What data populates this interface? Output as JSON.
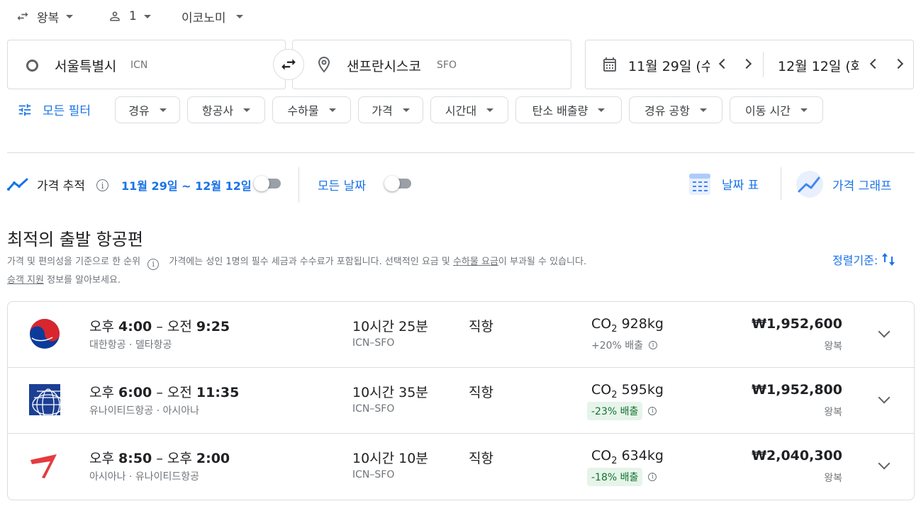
{
  "top": {
    "trip_type": "왕복",
    "passengers": "1",
    "cabin": "이코노미"
  },
  "search": {
    "origin_city": "서울특별시",
    "origin_code": "ICN",
    "dest_city": "샌프란시스코",
    "dest_code": "SFO",
    "depart_date": "11월 29일 (수",
    "return_date": "12월 12일 (화"
  },
  "filters": {
    "all_filters": "모든 필터",
    "chips": [
      "경유",
      "항공사",
      "수하물",
      "가격",
      "시간대",
      "탄소 배출량",
      "경유 공항",
      "이동 시간"
    ]
  },
  "tracker": {
    "label": "가격 추적",
    "range": "11월 29일 ~ 12월 12일",
    "all_dates": "모든 날짜",
    "date_grid": "날짜 표",
    "price_graph": "가격 그래프"
  },
  "results": {
    "heading": "최적의 출발 항공편",
    "sub_rank": "가격 및 편의성을 기준으로 한 순위",
    "sub_notice_1": "가격에는 성인 1명의 필수 세금과 수수료가 포함됩니다. 선택적인 요금 및 ",
    "sub_baggage_link": "수하물 요금",
    "sub_notice_2": "이 부과될 수 있습니다.",
    "sub_assist_link": "승객 지원",
    "sub_assist_text": " 정보를 알아보세요.",
    "sort_label": "정렬기준:"
  },
  "flights": [
    {
      "time_prefix1": "오후",
      "time1": "4:00",
      "time_prefix2": "오전",
      "time2": "9:25",
      "airline": "대한항공 · 델타항공",
      "duration": "10시간 25분",
      "route": "ICN–SFO",
      "stops": "직항",
      "co2_prefix": "CO",
      "co2_value": "928kg",
      "emission": "+20% 배출",
      "emission_style": "plain",
      "price": "₩1,952,600",
      "price_type": "왕복",
      "logo": "korean-air-logo"
    },
    {
      "time_prefix1": "오후",
      "time1": "6:00",
      "time_prefix2": "오전",
      "time2": "11:35",
      "airline": "유나이티드항공 · 아시아나",
      "duration": "10시간 35분",
      "route": "ICN–SFO",
      "stops": "직항",
      "co2_prefix": "CO",
      "co2_value": "595kg",
      "emission": "-23% 배출",
      "emission_style": "green",
      "price": "₩1,952,800",
      "price_type": "왕복",
      "logo": "united-logo"
    },
    {
      "time_prefix1": "오후",
      "time1": "8:50",
      "time_prefix2": "오후",
      "time2": "2:00",
      "airline": "아시아나 · 유나이티드항공",
      "duration": "10시간 10분",
      "route": "ICN–SFO",
      "stops": "직항",
      "co2_prefix": "CO",
      "co2_value": "634kg",
      "emission": "-18% 배출",
      "emission_style": "green",
      "price": "₩2,040,300",
      "price_type": "왕복",
      "logo": "asiana-logo"
    }
  ],
  "colors": {
    "accent": "#1a73e8",
    "green_bg": "#e6f4ea",
    "green_text": "#137333",
    "border": "#dadce0"
  }
}
